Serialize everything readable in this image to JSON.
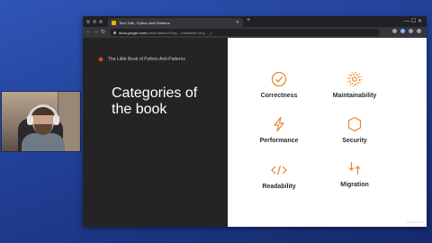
{
  "browser": {
    "tab_title": "Tech Talk - Python Anti-Patterns",
    "new_tab": "+",
    "window_controls": "— ☐ ✕",
    "url_host": "docs.google.com",
    "url_rest": "/presentation/d/1eg…/edit#slide=id.g…_1",
    "nav": {
      "back": "←",
      "forward": "→",
      "reload": "↻"
    }
  },
  "slide": {
    "book_title": "The Little Book of Python Anti-Patterns",
    "heading": "Categories of the book",
    "categories": [
      {
        "label": "Correctness",
        "icon": "check-circle-icon"
      },
      {
        "label": "Maintainability",
        "icon": "gear-icon"
      },
      {
        "label": "Performance",
        "icon": "lightning-icon"
      },
      {
        "label": "Security",
        "icon": "shield-icon"
      },
      {
        "label": "Readability",
        "icon": "code-icon"
      },
      {
        "label": "Migration",
        "icon": "swap-arrows-icon"
      }
    ],
    "accent_color": "#e8872b",
    "logo_color": "#e8471c"
  },
  "colors": {
    "desktop_background": "#213f95",
    "slide_dark": "#242424",
    "slide_light": "#ffffff"
  }
}
